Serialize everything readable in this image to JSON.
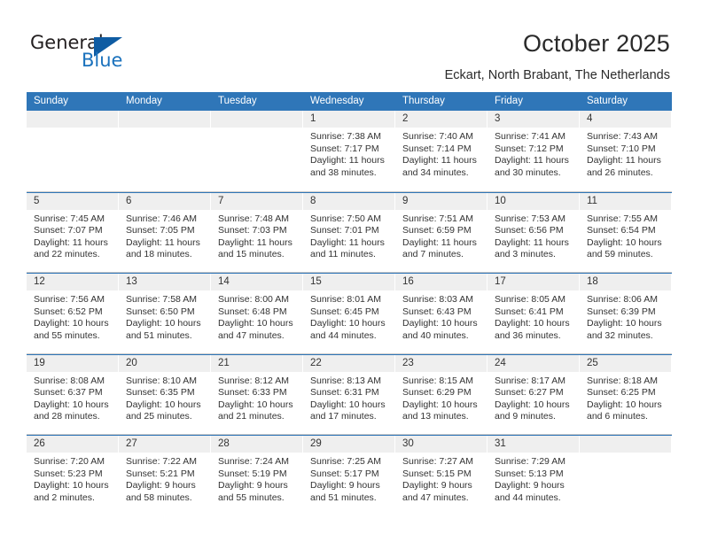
{
  "brand": {
    "name_part1": "General",
    "name_part2": "Blue",
    "logo_icon": "triangle-logo-icon",
    "accent_color": "#1b72bd"
  },
  "header": {
    "title": "October 2025",
    "subtitle": "Eckart, North Brabant, The Netherlands"
  },
  "theme": {
    "header_row_bg": "#2f76b8",
    "date_band_bg": "#efefef",
    "cell_bg": "#ffffff",
    "text_color": "#333333"
  },
  "calendar": {
    "day_headers": [
      "Sunday",
      "Monday",
      "Tuesday",
      "Wednesday",
      "Thursday",
      "Friday",
      "Saturday"
    ],
    "labels": {
      "sunrise": "Sunrise:",
      "sunset": "Sunset:",
      "daylight": "Daylight:"
    },
    "weeks": [
      [
        {
          "day": "",
          "empty": true
        },
        {
          "day": "",
          "empty": true
        },
        {
          "day": "",
          "empty": true
        },
        {
          "day": "1",
          "sunrise": "Sunrise: 7:38 AM",
          "sunset": "Sunset: 7:17 PM",
          "daylight1": "Daylight: 11 hours",
          "daylight2": "and 38 minutes."
        },
        {
          "day": "2",
          "sunrise": "Sunrise: 7:40 AM",
          "sunset": "Sunset: 7:14 PM",
          "daylight1": "Daylight: 11 hours",
          "daylight2": "and 34 minutes."
        },
        {
          "day": "3",
          "sunrise": "Sunrise: 7:41 AM",
          "sunset": "Sunset: 7:12 PM",
          "daylight1": "Daylight: 11 hours",
          "daylight2": "and 30 minutes."
        },
        {
          "day": "4",
          "sunrise": "Sunrise: 7:43 AM",
          "sunset": "Sunset: 7:10 PM",
          "daylight1": "Daylight: 11 hours",
          "daylight2": "and 26 minutes."
        }
      ],
      [
        {
          "day": "5",
          "sunrise": "Sunrise: 7:45 AM",
          "sunset": "Sunset: 7:07 PM",
          "daylight1": "Daylight: 11 hours",
          "daylight2": "and 22 minutes."
        },
        {
          "day": "6",
          "sunrise": "Sunrise: 7:46 AM",
          "sunset": "Sunset: 7:05 PM",
          "daylight1": "Daylight: 11 hours",
          "daylight2": "and 18 minutes."
        },
        {
          "day": "7",
          "sunrise": "Sunrise: 7:48 AM",
          "sunset": "Sunset: 7:03 PM",
          "daylight1": "Daylight: 11 hours",
          "daylight2": "and 15 minutes."
        },
        {
          "day": "8",
          "sunrise": "Sunrise: 7:50 AM",
          "sunset": "Sunset: 7:01 PM",
          "daylight1": "Daylight: 11 hours",
          "daylight2": "and 11 minutes."
        },
        {
          "day": "9",
          "sunrise": "Sunrise: 7:51 AM",
          "sunset": "Sunset: 6:59 PM",
          "daylight1": "Daylight: 11 hours",
          "daylight2": "and 7 minutes."
        },
        {
          "day": "10",
          "sunrise": "Sunrise: 7:53 AM",
          "sunset": "Sunset: 6:56 PM",
          "daylight1": "Daylight: 11 hours",
          "daylight2": "and 3 minutes."
        },
        {
          "day": "11",
          "sunrise": "Sunrise: 7:55 AM",
          "sunset": "Sunset: 6:54 PM",
          "daylight1": "Daylight: 10 hours",
          "daylight2": "and 59 minutes."
        }
      ],
      [
        {
          "day": "12",
          "sunrise": "Sunrise: 7:56 AM",
          "sunset": "Sunset: 6:52 PM",
          "daylight1": "Daylight: 10 hours",
          "daylight2": "and 55 minutes."
        },
        {
          "day": "13",
          "sunrise": "Sunrise: 7:58 AM",
          "sunset": "Sunset: 6:50 PM",
          "daylight1": "Daylight: 10 hours",
          "daylight2": "and 51 minutes."
        },
        {
          "day": "14",
          "sunrise": "Sunrise: 8:00 AM",
          "sunset": "Sunset: 6:48 PM",
          "daylight1": "Daylight: 10 hours",
          "daylight2": "and 47 minutes."
        },
        {
          "day": "15",
          "sunrise": "Sunrise: 8:01 AM",
          "sunset": "Sunset: 6:45 PM",
          "daylight1": "Daylight: 10 hours",
          "daylight2": "and 44 minutes."
        },
        {
          "day": "16",
          "sunrise": "Sunrise: 8:03 AM",
          "sunset": "Sunset: 6:43 PM",
          "daylight1": "Daylight: 10 hours",
          "daylight2": "and 40 minutes."
        },
        {
          "day": "17",
          "sunrise": "Sunrise: 8:05 AM",
          "sunset": "Sunset: 6:41 PM",
          "daylight1": "Daylight: 10 hours",
          "daylight2": "and 36 minutes."
        },
        {
          "day": "18",
          "sunrise": "Sunrise: 8:06 AM",
          "sunset": "Sunset: 6:39 PM",
          "daylight1": "Daylight: 10 hours",
          "daylight2": "and 32 minutes."
        }
      ],
      [
        {
          "day": "19",
          "sunrise": "Sunrise: 8:08 AM",
          "sunset": "Sunset: 6:37 PM",
          "daylight1": "Daylight: 10 hours",
          "daylight2": "and 28 minutes."
        },
        {
          "day": "20",
          "sunrise": "Sunrise: 8:10 AM",
          "sunset": "Sunset: 6:35 PM",
          "daylight1": "Daylight: 10 hours",
          "daylight2": "and 25 minutes."
        },
        {
          "day": "21",
          "sunrise": "Sunrise: 8:12 AM",
          "sunset": "Sunset: 6:33 PM",
          "daylight1": "Daylight: 10 hours",
          "daylight2": "and 21 minutes."
        },
        {
          "day": "22",
          "sunrise": "Sunrise: 8:13 AM",
          "sunset": "Sunset: 6:31 PM",
          "daylight1": "Daylight: 10 hours",
          "daylight2": "and 17 minutes."
        },
        {
          "day": "23",
          "sunrise": "Sunrise: 8:15 AM",
          "sunset": "Sunset: 6:29 PM",
          "daylight1": "Daylight: 10 hours",
          "daylight2": "and 13 minutes."
        },
        {
          "day": "24",
          "sunrise": "Sunrise: 8:17 AM",
          "sunset": "Sunset: 6:27 PM",
          "daylight1": "Daylight: 10 hours",
          "daylight2": "and 9 minutes."
        },
        {
          "day": "25",
          "sunrise": "Sunrise: 8:18 AM",
          "sunset": "Sunset: 6:25 PM",
          "daylight1": "Daylight: 10 hours",
          "daylight2": "and 6 minutes."
        }
      ],
      [
        {
          "day": "26",
          "sunrise": "Sunrise: 7:20 AM",
          "sunset": "Sunset: 5:23 PM",
          "daylight1": "Daylight: 10 hours",
          "daylight2": "and 2 minutes."
        },
        {
          "day": "27",
          "sunrise": "Sunrise: 7:22 AM",
          "sunset": "Sunset: 5:21 PM",
          "daylight1": "Daylight: 9 hours",
          "daylight2": "and 58 minutes."
        },
        {
          "day": "28",
          "sunrise": "Sunrise: 7:24 AM",
          "sunset": "Sunset: 5:19 PM",
          "daylight1": "Daylight: 9 hours",
          "daylight2": "and 55 minutes."
        },
        {
          "day": "29",
          "sunrise": "Sunrise: 7:25 AM",
          "sunset": "Sunset: 5:17 PM",
          "daylight1": "Daylight: 9 hours",
          "daylight2": "and 51 minutes."
        },
        {
          "day": "30",
          "sunrise": "Sunrise: 7:27 AM",
          "sunset": "Sunset: 5:15 PM",
          "daylight1": "Daylight: 9 hours",
          "daylight2": "and 47 minutes."
        },
        {
          "day": "31",
          "sunrise": "Sunrise: 7:29 AM",
          "sunset": "Sunset: 5:13 PM",
          "daylight1": "Daylight: 9 hours",
          "daylight2": "and 44 minutes."
        },
        {
          "day": "",
          "empty": true
        }
      ]
    ]
  }
}
